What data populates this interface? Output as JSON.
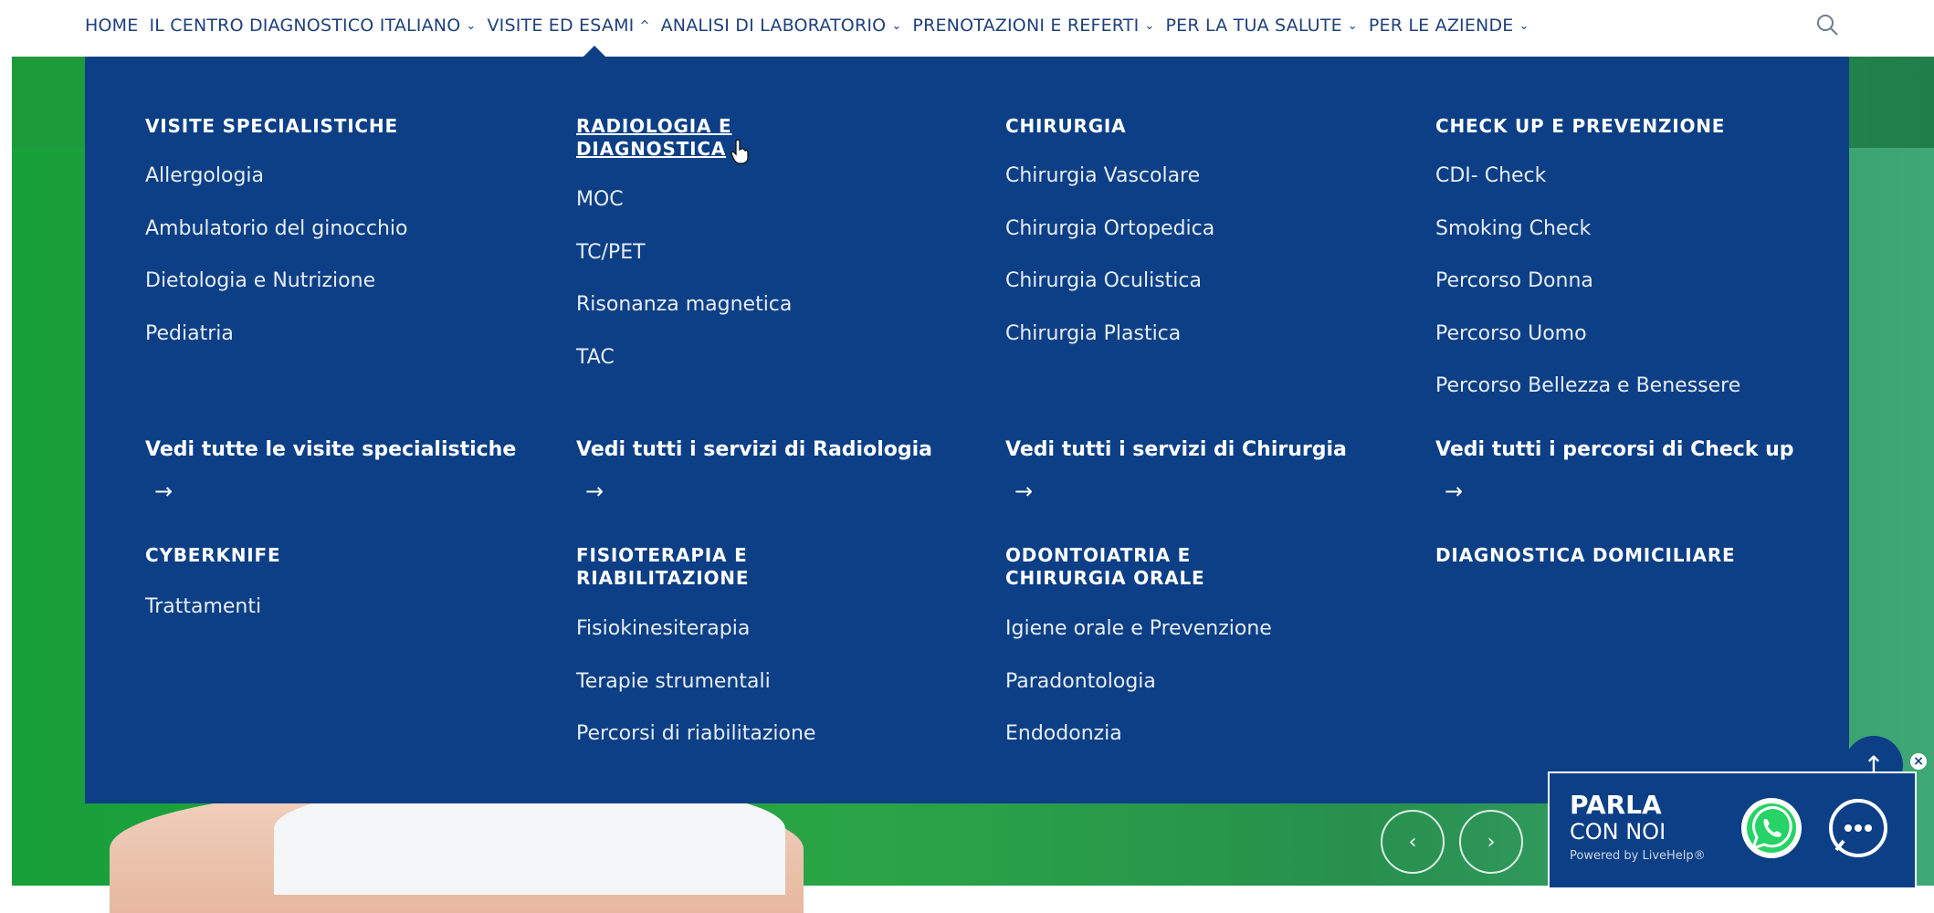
{
  "nav": {
    "items": [
      {
        "label": "HOME",
        "chevron": ""
      },
      {
        "label": "IL CENTRO DIAGNOSTICO ITALIANO",
        "chevron": "⌄"
      },
      {
        "label": "VISITE ED ESAMI",
        "chevron": "^"
      },
      {
        "label": "ANALISI DI LABORATORIO",
        "chevron": "⌄"
      },
      {
        "label": "PRENOTAZIONI E REFERTI",
        "chevron": "⌄"
      },
      {
        "label": "PER LA TUA SALUTE",
        "chevron": "⌄"
      },
      {
        "label": "PER LE AZIENDE",
        "chevron": "⌄"
      }
    ],
    "search_icon": "search-icon"
  },
  "menu": {
    "visite": {
      "title": "VISITE SPECIALISTICHE",
      "items": [
        "Allergologia",
        "Ambulatorio del ginocchio",
        "Dietologia e Nutrizione",
        "Pediatria"
      ],
      "see_all": "Vedi tutte le visite specialistiche"
    },
    "radiologia": {
      "title_line1": "RADIOLOGIA E",
      "title_line2": "DIAGNOSTICA",
      "items": [
        "MOC",
        "TC/PET",
        "Risonanza magnetica",
        "TAC"
      ],
      "see_all": "Vedi tutti i servizi di Radiologia"
    },
    "chirurgia": {
      "title": "CHIRURGIA",
      "items": [
        "Chirurgia Vascolare",
        "Chirurgia Ortopedica",
        "Chirurgia Oculistica",
        "Chirurgia Plastica"
      ],
      "see_all": "Vedi tutti i servizi di Chirurgia"
    },
    "checkup": {
      "title": "CHECK UP E PREVENZIONE",
      "items": [
        "CDI- Check",
        "Smoking Check",
        "Percorso Donna",
        "Percorso Uomo",
        "Percorso Bellezza e Benessere"
      ],
      "see_all": "Vedi tutti i percorsi di Check up"
    },
    "arrow": "→",
    "cyberknife": {
      "title": "CYBERKNIFE",
      "items": [
        "Trattamenti"
      ]
    },
    "fisioterapia": {
      "title_line1": "FISIOTERAPIA E",
      "title_line2": "RIABILITAZIONE",
      "items": [
        "Fisiokinesiterapia",
        "Terapie strumentali",
        "Percorsi di riabilitazione"
      ]
    },
    "odontoiatria": {
      "title_line1": "ODONTOIATRIA E",
      "title_line2": "CHIRURGIA ORALE",
      "items": [
        "Igiene orale e Prevenzione",
        "Paradontologia",
        "Endodonzia"
      ]
    },
    "domiciliare": {
      "title": "DIAGNOSTICA DOMICILIARE"
    }
  },
  "chat": {
    "line1": "PARLA",
    "line2": "CON NOI",
    "powered": "Powered by LiveHelp®",
    "close": "×"
  },
  "scroll_top": "↑",
  "carousel": {
    "prev": "‹",
    "next": "›"
  },
  "colors": {
    "menu_bg": "#0c3f86",
    "nav_text": "#1d3f7c",
    "hero_green": "#22a043"
  }
}
